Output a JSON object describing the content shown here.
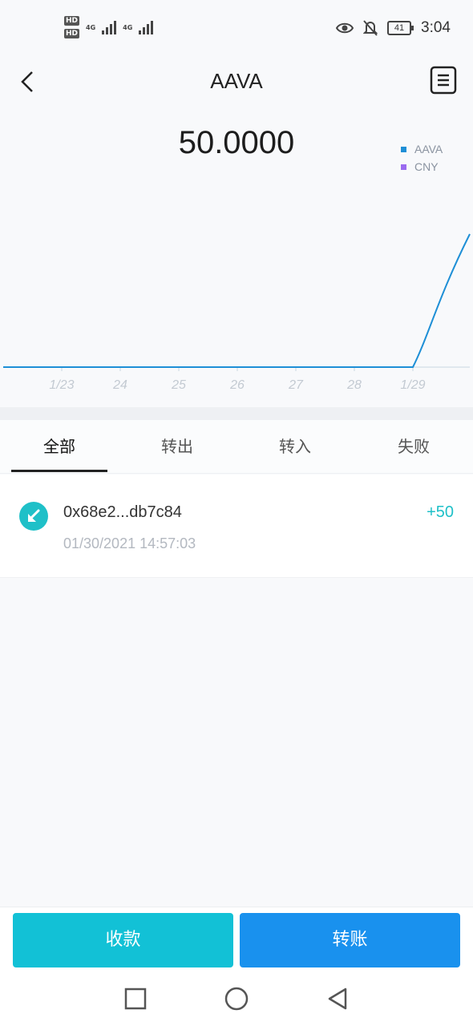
{
  "status_bar": {
    "sim1": "HD",
    "sim2": "HD",
    "net1": "4G",
    "net2": "4G",
    "battery": "41",
    "time": "3:04"
  },
  "nav": {
    "title": "AAVA",
    "back_icon": "chevron-left-icon",
    "menu_icon": "document-list-icon"
  },
  "balance": "50.0000",
  "legend": [
    {
      "label": "AAVA",
      "color": "#1e8fd6"
    },
    {
      "label": "CNY",
      "color": "#9b6bf0"
    }
  ],
  "chart_data": {
    "type": "line",
    "categories": [
      "1/23",
      "24",
      "25",
      "26",
      "27",
      "28",
      "1/29"
    ],
    "series": [
      {
        "name": "AAVA",
        "values": [
          0,
          0,
          0,
          0,
          0,
          0,
          0,
          50
        ],
        "color": "#1e8fd6"
      }
    ],
    "x_positions": [
      0,
      1,
      2,
      3,
      4,
      5,
      6,
      7
    ],
    "grid": false
  },
  "tabs": [
    {
      "label": "全部",
      "active": true
    },
    {
      "label": "转出",
      "active": false
    },
    {
      "label": "转入",
      "active": false
    },
    {
      "label": "失败",
      "active": false
    }
  ],
  "transactions": [
    {
      "hash": "0x68e2...db7c84",
      "time": "01/30/2021 14:57:03",
      "amount": "+50",
      "icon": "incoming-arrow-icon",
      "color": "#1fc0c8"
    }
  ],
  "actions": {
    "receive": "收款",
    "transfer": "转账"
  },
  "system_nav": [
    "square-icon",
    "circle-icon",
    "triangle-back-icon"
  ]
}
